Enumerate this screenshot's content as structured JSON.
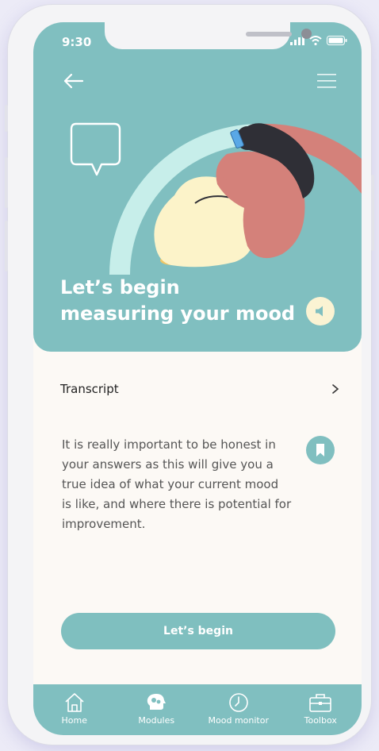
{
  "status_bar": {
    "time": "9:30"
  },
  "hero": {
    "title_line1": "Let’s begin",
    "title_line2": "measuring your mood",
    "icons": [
      "back-arrow-icon",
      "menu-icon",
      "speech-bubble-icon",
      "speaker-icon"
    ]
  },
  "transcript": {
    "label": "Transcript"
  },
  "content": {
    "line1": "It is really important to be honest in",
    "line2": "your answers as this will give you a",
    "line3": "true idea of what your current mood",
    "line4": "is like, and where there is potential for",
    "line5": "improvement."
  },
  "cta": {
    "label": "Let’s begin"
  },
  "tabbar": {
    "items": [
      {
        "label": "Home",
        "icon": "home-icon"
      },
      {
        "label": "Modules",
        "icon": "head-gears-icon"
      },
      {
        "label": "Mood monitor",
        "icon": "clock-icon"
      },
      {
        "label": "Toolbox",
        "icon": "toolbox-icon"
      }
    ]
  },
  "colors": {
    "teal": "#80bfc0",
    "cream": "#fcf9f5",
    "accent_pink": "#d4817a",
    "pale_yellow": "#fbf3d3"
  }
}
